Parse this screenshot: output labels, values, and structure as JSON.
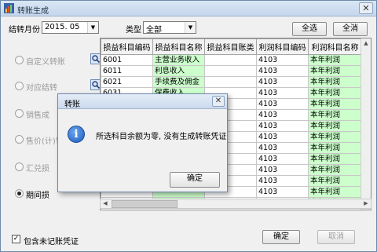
{
  "window": {
    "title": "转账生成",
    "close_glyph": "✕"
  },
  "filters": {
    "period_label": "结转月份",
    "period_value": "2015. 05",
    "type_label": "类型",
    "type_value": "全部"
  },
  "buttons": {
    "select_all": "全选",
    "deselect_all": "全消",
    "ok": "确定",
    "cancel": "取消"
  },
  "options": [
    {
      "label": "自定义转账",
      "active": false,
      "has_search": true
    },
    {
      "label": "对应结转",
      "active": false,
      "has_search": true
    },
    {
      "label": "销售成",
      "active": false,
      "has_search": false
    },
    {
      "label": "售价(计)销售成",
      "active": false,
      "has_search": false
    },
    {
      "label": "汇兑损",
      "active": false,
      "has_search": false
    },
    {
      "label": "期间损",
      "active": true,
      "has_search": false
    }
  ],
  "table": {
    "columns": [
      "损益科目编码",
      "损益科目名称",
      "损益科目账类",
      "利润科目编码",
      "利润科目名称"
    ],
    "rows": [
      [
        "6001",
        "主营业务收入",
        "",
        "4103",
        "本年利润"
      ],
      [
        "6011",
        "利息收入",
        "",
        "4103",
        "本年利润"
      ],
      [
        "6021",
        "手续费及佣金",
        "",
        "4103",
        "本年利润"
      ],
      [
        "6031",
        "保费收入",
        "",
        "4103",
        "本年利润"
      ],
      [
        "",
        "",
        "",
        "4103",
        "本年利润"
      ],
      [
        "",
        "",
        "",
        "4103",
        "本年利润"
      ],
      [
        "",
        "",
        "",
        "4103",
        "本年利润"
      ],
      [
        "",
        "",
        "",
        "4103",
        "本年利润"
      ],
      [
        "",
        "",
        "",
        "4103",
        "本年利润"
      ],
      [
        "",
        "",
        "",
        "4103",
        "本年利润"
      ],
      [
        "",
        "",
        "",
        "4103",
        "本年利润"
      ],
      [
        "",
        "",
        "",
        "4103",
        "本年利润"
      ],
      [
        "",
        "",
        "",
        "4103",
        "本年利润"
      ],
      [
        "",
        "",
        "",
        "4103",
        "本年利润"
      ]
    ]
  },
  "include_unposted": {
    "label": "包含未记账凭证",
    "checked": true
  },
  "dialog": {
    "title": "转账",
    "message": "所选科目余额为零, 没有生成转账凭证",
    "ok_label": "确定",
    "icon": "info-icon"
  },
  "colors": {
    "grid_highlight": "#ccffcc",
    "titlebar": "#c5d7ec"
  }
}
